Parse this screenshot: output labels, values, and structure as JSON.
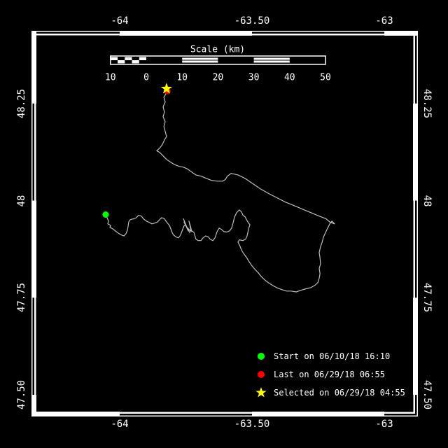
{
  "colors": {
    "background": "#000000",
    "frame": "#FFFFFF",
    "text": "#FFFFFF",
    "track": "#BEBEBE",
    "start": "#00FF00",
    "last": "#FF0000",
    "selected": "#FFFF00"
  },
  "axes": {
    "top": {
      "labels": [
        "-64",
        "-63.50",
        "-63"
      ]
    },
    "bottom": {
      "labels": [
        "-64",
        "-63.50",
        "-63"
      ]
    },
    "left": {
      "labels": [
        "48.25",
        "48",
        "47.75",
        "47.50"
      ]
    },
    "right": {
      "labels": [
        "48.25",
        "48",
        "47.75",
        "47.50"
      ]
    }
  },
  "scale_bar": {
    "title": "Scale (km)",
    "labels": [
      "10",
      "0",
      "10",
      "20",
      "30",
      "40",
      "50"
    ],
    "values_km": [
      -10,
      0,
      10,
      20,
      30,
      40,
      50
    ]
  },
  "legend": [
    {
      "marker": "circle",
      "color": "#00FF00",
      "label": "Start on 06/10/18 16:10"
    },
    {
      "marker": "circle",
      "color": "#FF0000",
      "label": "Last on 06/29/18 06:55"
    },
    {
      "marker": "star",
      "color": "#FFFF00",
      "label": "Selected on 06/29/18 04:55"
    }
  ],
  "chart_data": {
    "type": "line",
    "title": "Animal track map",
    "lon_ticks": [
      -64,
      -63.5,
      -63
    ],
    "lat_ticks": [
      48.25,
      48.0,
      47.75,
      47.5
    ],
    "lon_range": [
      -64.3307,
      -62.8889
    ],
    "lat_range": [
      47.446,
      48.437
    ],
    "grid": false,
    "legend_position": "bottom-right",
    "markers": {
      "start": {
        "lon": -64.053,
        "lat": 47.964,
        "label": "Start on 06/10/18 16:10"
      },
      "last": {
        "lon": -63.82,
        "lat": 48.282,
        "label": "Last on 06/29/18 06:55"
      },
      "selected": {
        "lon": -63.823,
        "lat": 48.288,
        "label": "Selected on 06/29/18 04:55"
      }
    },
    "track": [
      [
        -64.053,
        47.964
      ],
      [
        -64.048,
        47.956
      ],
      [
        -64.042,
        47.947
      ],
      [
        -64.045,
        47.94
      ],
      [
        -64.034,
        47.936
      ],
      [
        -64.037,
        47.931
      ],
      [
        -64.026,
        47.927
      ],
      [
        -64.013,
        47.92
      ],
      [
        -64.003,
        47.915
      ],
      [
        -63.992,
        47.911
      ],
      [
        -63.984,
        47.909
      ],
      [
        -63.976,
        47.915
      ],
      [
        -63.971,
        47.924
      ],
      [
        -63.968,
        47.935
      ],
      [
        -63.966,
        47.945
      ],
      [
        -63.96,
        47.951
      ],
      [
        -63.947,
        47.953
      ],
      [
        -63.937,
        47.956
      ],
      [
        -63.929,
        47.962
      ],
      [
        -63.918,
        47.96
      ],
      [
        -63.91,
        47.953
      ],
      [
        -63.899,
        47.947
      ],
      [
        -63.889,
        47.944
      ],
      [
        -63.878,
        47.94
      ],
      [
        -63.868,
        47.942
      ],
      [
        -63.857,
        47.945
      ],
      [
        -63.849,
        47.951
      ],
      [
        -63.841,
        47.956
      ],
      [
        -63.831,
        47.953
      ],
      [
        -63.823,
        47.945
      ],
      [
        -63.812,
        47.936
      ],
      [
        -63.807,
        47.927
      ],
      [
        -63.802,
        47.918
      ],
      [
        -63.796,
        47.911
      ],
      [
        -63.786,
        47.906
      ],
      [
        -63.778,
        47.904
      ],
      [
        -63.772,
        47.909
      ],
      [
        -63.767,
        47.917
      ],
      [
        -63.762,
        47.926
      ],
      [
        -63.757,
        47.935
      ],
      [
        -63.751,
        47.938
      ],
      [
        -63.759,
        47.953
      ],
      [
        -63.746,
        47.931
      ],
      [
        -63.757,
        47.945
      ],
      [
        -63.741,
        47.922
      ],
      [
        -63.749,
        47.936
      ],
      [
        -63.735,
        47.917
      ],
      [
        -63.743,
        47.929
      ],
      [
        -63.73,
        47.92
      ],
      [
        -63.738,
        47.947
      ],
      [
        -63.728,
        47.922
      ],
      [
        -63.72,
        47.919
      ],
      [
        -63.712,
        47.901
      ],
      [
        -63.704,
        47.897
      ],
      [
        -63.693,
        47.897
      ],
      [
        -63.685,
        47.904
      ],
      [
        -63.675,
        47.909
      ],
      [
        -63.664,
        47.906
      ],
      [
        -63.659,
        47.901
      ],
      [
        -63.648,
        47.897
      ],
      [
        -63.64,
        47.904
      ],
      [
        -63.632,
        47.92
      ],
      [
        -63.624,
        47.929
      ],
      [
        -63.616,
        47.926
      ],
      [
        -63.606,
        47.92
      ],
      [
        -63.595,
        47.919
      ],
      [
        -63.585,
        47.922
      ],
      [
        -63.577,
        47.929
      ],
      [
        -63.571,
        47.944
      ],
      [
        -63.566,
        47.958
      ],
      [
        -63.558,
        47.969
      ],
      [
        -63.548,
        47.976
      ],
      [
        -63.54,
        47.971
      ],
      [
        -63.534,
        47.962
      ],
      [
        -63.526,
        47.958
      ],
      [
        -63.521,
        47.951
      ],
      [
        -63.513,
        47.942
      ],
      [
        -63.508,
        47.938
      ],
      [
        -63.513,
        47.927
      ],
      [
        -63.516,
        47.917
      ],
      [
        -63.519,
        47.908
      ],
      [
        -63.524,
        47.901
      ],
      [
        -63.534,
        47.897
      ],
      [
        -63.548,
        47.899
      ],
      [
        -63.553,
        47.893
      ],
      [
        -63.545,
        47.882
      ],
      [
        -63.54,
        47.873
      ],
      [
        -63.532,
        47.864
      ],
      [
        -63.521,
        47.854
      ],
      [
        -63.511,
        47.843
      ],
      [
        -63.5,
        47.832
      ],
      [
        -63.489,
        47.823
      ],
      [
        -63.476,
        47.814
      ],
      [
        -63.466,
        47.805
      ],
      [
        -63.452,
        47.796
      ],
      [
        -63.439,
        47.789
      ],
      [
        -63.423,
        47.782
      ],
      [
        -63.407,
        47.776
      ],
      [
        -63.389,
        47.771
      ],
      [
        -63.37,
        47.767
      ],
      [
        -63.352,
        47.767
      ],
      [
        -63.333,
        47.765
      ],
      [
        -63.315,
        47.769
      ],
      [
        -63.296,
        47.773
      ],
      [
        -63.278,
        47.776
      ],
      [
        -63.262,
        47.782
      ],
      [
        -63.251,
        47.789
      ],
      [
        -63.246,
        47.8
      ],
      [
        -63.243,
        47.812
      ],
      [
        -63.246,
        47.825
      ],
      [
        -63.241,
        47.837
      ],
      [
        -63.243,
        47.852
      ],
      [
        -63.246,
        47.866
      ],
      [
        -63.241,
        47.881
      ],
      [
        -63.235,
        47.893
      ],
      [
        -63.23,
        47.906
      ],
      [
        -63.222,
        47.918
      ],
      [
        -63.214,
        47.929
      ],
      [
        -63.206,
        47.94
      ],
      [
        -63.198,
        47.947
      ],
      [
        -63.188,
        47.94
      ],
      [
        -63.204,
        47.944
      ],
      [
        -63.22,
        47.953
      ],
      [
        -63.246,
        47.96
      ],
      [
        -63.278,
        47.969
      ],
      [
        -63.31,
        47.978
      ],
      [
        -63.341,
        47.987
      ],
      [
        -63.373,
        47.996
      ],
      [
        -63.405,
        48.007
      ],
      [
        -63.437,
        48.018
      ],
      [
        -63.468,
        48.03
      ],
      [
        -63.5,
        48.045
      ],
      [
        -63.526,
        48.057
      ],
      [
        -63.553,
        48.066
      ],
      [
        -63.579,
        48.07
      ],
      [
        -63.593,
        48.063
      ],
      [
        -63.601,
        48.054
      ],
      [
        -63.611,
        48.05
      ],
      [
        -63.632,
        48.05
      ],
      [
        -63.653,
        48.052
      ],
      [
        -63.672,
        48.057
      ],
      [
        -63.693,
        48.063
      ],
      [
        -63.712,
        48.066
      ],
      [
        -63.725,
        48.072
      ],
      [
        -63.743,
        48.081
      ],
      [
        -63.759,
        48.086
      ],
      [
        -63.775,
        48.088
      ],
      [
        -63.794,
        48.093
      ],
      [
        -63.81,
        48.1
      ],
      [
        -63.823,
        48.106
      ],
      [
        -63.836,
        48.115
      ],
      [
        -63.849,
        48.124
      ],
      [
        -63.86,
        48.128
      ],
      [
        -63.849,
        48.135
      ],
      [
        -63.839,
        48.144
      ],
      [
        -63.831,
        48.156
      ],
      [
        -63.823,
        48.165
      ],
      [
        -63.828,
        48.178
      ],
      [
        -63.833,
        48.191
      ],
      [
        -63.828,
        48.203
      ],
      [
        -63.836,
        48.216
      ],
      [
        -63.831,
        48.228
      ],
      [
        -63.836,
        48.241
      ],
      [
        -63.828,
        48.254
      ],
      [
        -63.833,
        48.266
      ],
      [
        -63.825,
        48.275
      ],
      [
        -63.82,
        48.282
      ]
    ]
  }
}
